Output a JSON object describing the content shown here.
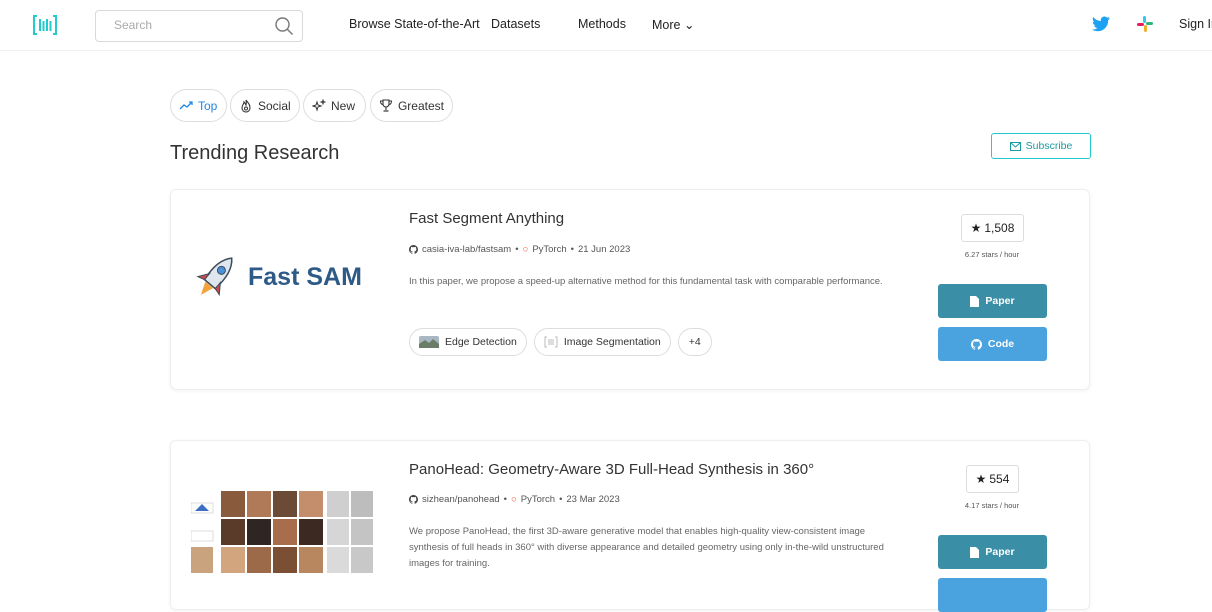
{
  "header": {
    "search_placeholder": "Search",
    "nav": {
      "browse": "Browse State-of-the-Art",
      "datasets": "Datasets",
      "methods": "Methods",
      "more": "More"
    },
    "signin": "Sign In"
  },
  "filters": {
    "top": "Top",
    "social": "Social",
    "new": "New",
    "greatest": "Greatest"
  },
  "page_title": "Trending Research",
  "subscribe_label": "Subscribe",
  "papers": [
    {
      "thumb_text": "Fast SAM",
      "title": "Fast Segment Anything",
      "repo": "casia-iva-lab/fastsam",
      "framework": "PyTorch",
      "date": "21 Jun 2023",
      "abstract": "In this paper, we propose a speed-up alternative method for this fundamental task with comparable performance.",
      "tags": [
        "Edge Detection",
        "Image Segmentation"
      ],
      "more_tags": "+4",
      "stars": "1,508",
      "rate": "6.27 stars / hour",
      "paper_label": "Paper",
      "code_label": "Code"
    },
    {
      "title": "PanoHead: Geometry-Aware 3D Full-Head Synthesis in 360°",
      "repo": "sizhean/panohead",
      "framework": "PyTorch",
      "date": "23 Mar 2023",
      "abstract": "We propose PanoHead, the first 3D-aware generative model that enables high-quality view-consistent image synthesis of full heads in 360° with diverse appearance and detailed geometry using only in-the-wild unstructured images for training.",
      "stars": "554",
      "rate": "4.17 stars / hour",
      "paper_label": "Paper"
    }
  ],
  "colors": {
    "accent": "#21cbce",
    "paper_button": "#3a8fa7",
    "code_button": "#4aa3df",
    "twitter": "#1da1f2"
  }
}
